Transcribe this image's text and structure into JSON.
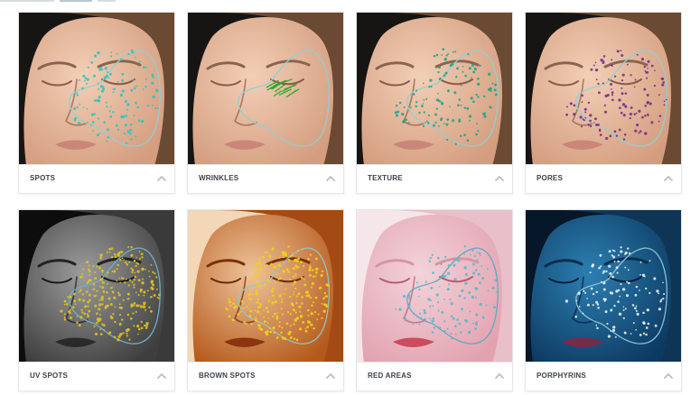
{
  "analysis_tiles": [
    {
      "label": "SPOTS",
      "theme": "natural",
      "marker_color": "#2bc7c0",
      "contour_color": "#8fd0d6",
      "icon": "chevron-up-icon"
    },
    {
      "label": "WRINKLES",
      "theme": "natural",
      "marker_color": "#2ea82c",
      "contour_color": "#8fd0d6",
      "icon": "chevron-up-icon"
    },
    {
      "label": "TEXTURE",
      "theme": "natural",
      "marker_color": "#1fa68a",
      "contour_color": "#8fd0d6",
      "icon": "chevron-up-icon"
    },
    {
      "label": "PORES",
      "theme": "natural",
      "marker_color": "#7a2c8c",
      "contour_color": "#8fd0d6",
      "icon": "chevron-up-icon"
    },
    {
      "label": "UV SPOTS",
      "theme": "grayscale",
      "marker_color": "#e0c21e",
      "contour_color": "#6fb3c9",
      "icon": "chevron-up-icon"
    },
    {
      "label": "BROWN SPOTS",
      "theme": "brown",
      "marker_color": "#f0d21a",
      "contour_color": "#8fc9c6",
      "icon": "chevron-up-icon"
    },
    {
      "label": "RED AREAS",
      "theme": "red",
      "marker_color": "#5bb9c6",
      "contour_color": "#5aa9c3",
      "icon": "chevron-up-icon"
    },
    {
      "label": "PORPHYRINS",
      "theme": "blue",
      "marker_color": "#e8f2f2",
      "contour_color": "#8cc7d8",
      "icon": "chevron-up-icon"
    }
  ]
}
